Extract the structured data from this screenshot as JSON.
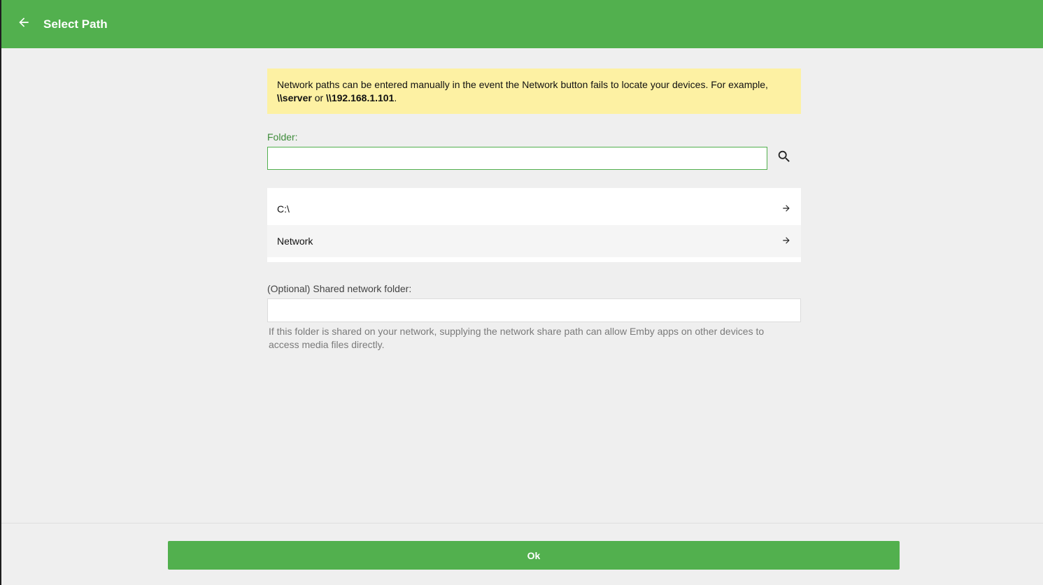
{
  "header": {
    "title": "Select Path",
    "back_icon": "arrow-left-icon",
    "background": "#52b04e"
  },
  "notice": {
    "text_before": "Network paths can be entered manually in the event the Network button fails to locate your devices. For example,",
    "example1": "\\\\server",
    "connector": "or",
    "example2": "\\\\192.168.1.101",
    "text_after": ".",
    "background": "#fdf1a3"
  },
  "folder": {
    "label": "Folder:",
    "value": "",
    "search_icon": "search-icon"
  },
  "directories": [
    {
      "label": "C:\\",
      "icon": "arrow-right-icon"
    },
    {
      "label": "Network",
      "icon": "arrow-right-icon"
    }
  ],
  "shared": {
    "label": "(Optional) Shared network folder:",
    "value": "",
    "helper": "If this folder is shared on your network, supplying the network share path can allow Emby apps on other devices to access media files directly."
  },
  "footer": {
    "ok_label": "Ok"
  }
}
